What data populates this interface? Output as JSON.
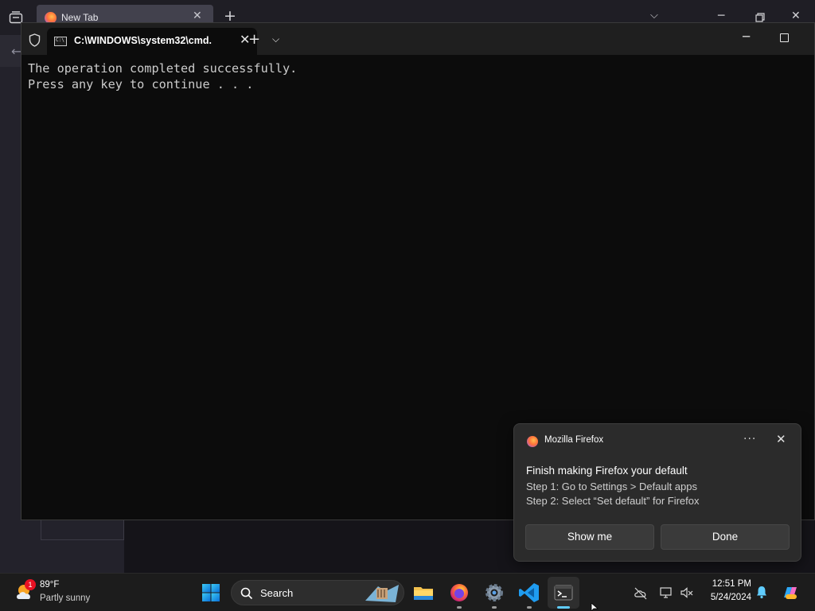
{
  "firefox": {
    "tab_title": "New Tab"
  },
  "terminal": {
    "tab_title": "C:\\WINDOWS\\system32\\cmd.",
    "tab_icon_text": "C:\\",
    "output_lines": [
      "The operation completed successfully.",
      "Press any key to continue . . ."
    ]
  },
  "notification": {
    "app_name": "Mozilla Firefox",
    "title": "Finish making Firefox your default",
    "lines": [
      "Step 1: Go to Settings > Default apps",
      "Step 2: Select “Set default” for Firefox"
    ],
    "buttons": {
      "primary": "Show me",
      "secondary": "Done"
    },
    "more_label": "···"
  },
  "taskbar": {
    "weather": {
      "badge": "1",
      "temperature": "89°F",
      "condition": "Partly sunny"
    },
    "search_label": "Search",
    "apps": [
      "file-explorer",
      "firefox",
      "settings",
      "vscode",
      "terminal"
    ],
    "clock": {
      "time": "12:51 PM",
      "date": "5/24/2024"
    }
  },
  "colors": {
    "terminal_bg": "#0c0c0c",
    "terminal_text": "#cccccc",
    "taskbar_bg": "#1c1c1c",
    "accent": "#60cdff",
    "toast_bg": "#2b2b2b"
  }
}
